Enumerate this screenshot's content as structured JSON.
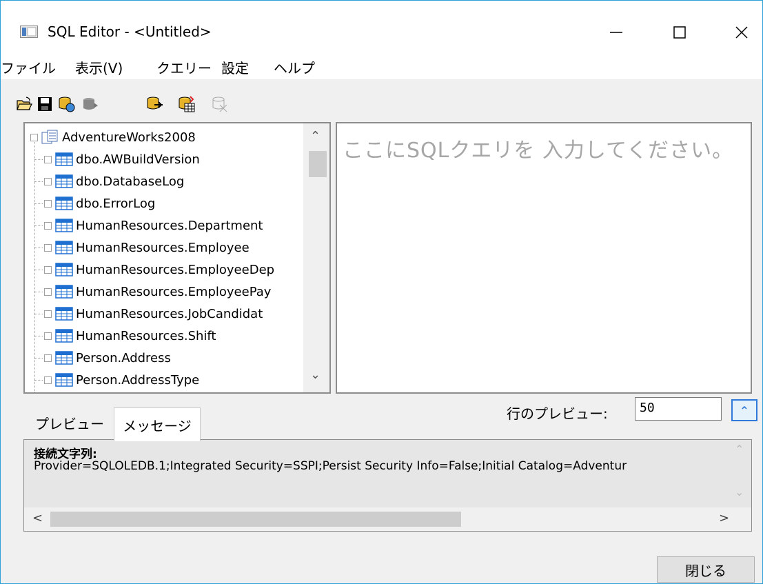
{
  "window": {
    "title": "SQL Editor - <Untitled>"
  },
  "menu": [
    "ファイル",
    "表示(V)",
    "クエリー",
    "設定",
    "ヘルプ"
  ],
  "toolbar": [
    "open-icon",
    "save-icon",
    "run-query-icon",
    "stop-icon",
    "connect-icon",
    "import-icon",
    "disconnect-icon"
  ],
  "tree": {
    "root": "AdventureWorks2008",
    "items": [
      "dbo.AWBuildVersion",
      "dbo.DatabaseLog",
      "dbo.ErrorLog",
      "HumanResources.Department",
      "HumanResources.Employee",
      "HumanResources.EmployeeDep",
      "HumanResources.EmployeePay",
      "HumanResources.JobCandidat",
      "HumanResources.Shift",
      "Person.Address",
      "Person.AddressType"
    ]
  },
  "editor": {
    "placeholder": "ここにSQLクエリを 入力してください。"
  },
  "preview": {
    "label": "行のプレビュー:",
    "value": "50"
  },
  "tabs": {
    "preview": "プレビュー",
    "messages": "メッセージ"
  },
  "messages": {
    "label": "接続文字列:",
    "text": "Provider=SQLOLEDB.1;Integrated Security=SSPI;Persist Security Info=False;Initial Catalog=Adventur"
  },
  "buttons": {
    "close": "閉じる"
  }
}
